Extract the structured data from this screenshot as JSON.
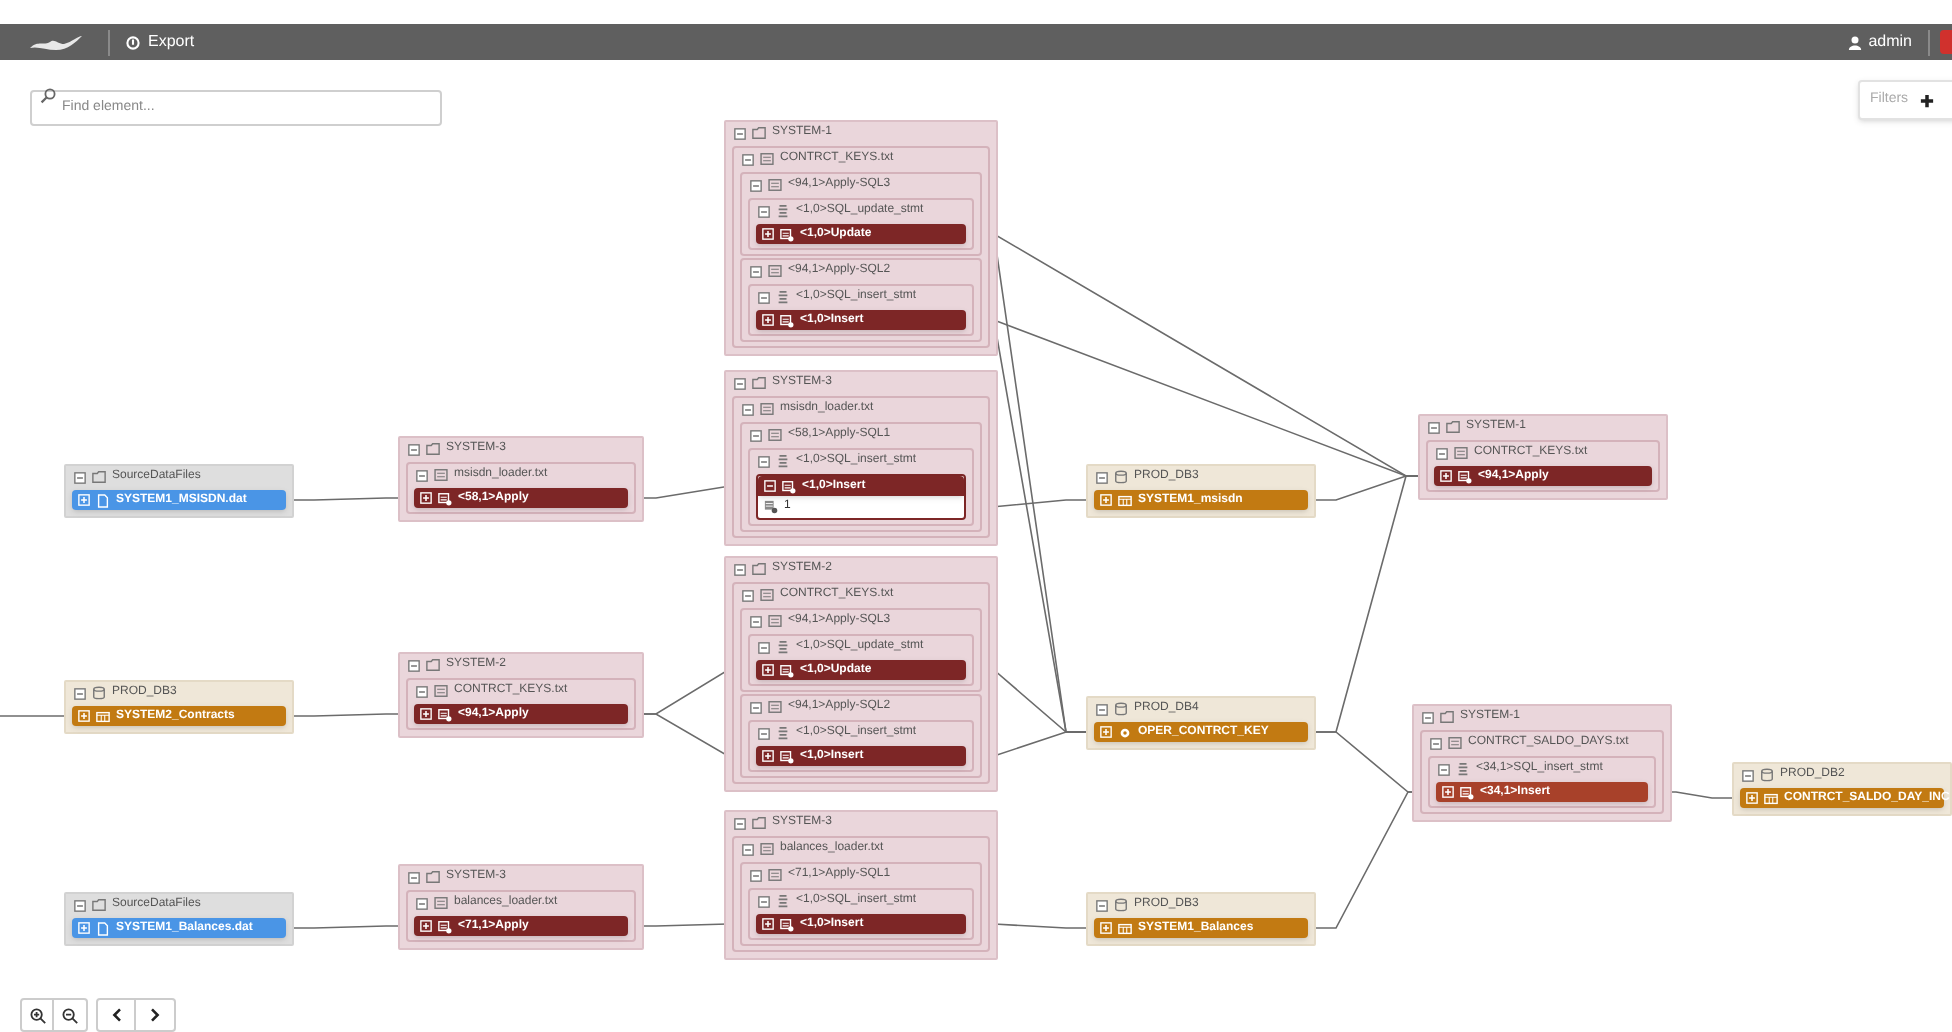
{
  "toolbar": {
    "export_label": "Export",
    "user": "admin"
  },
  "search": {
    "placeholder": "Find element..."
  },
  "filters": {
    "label": "Filters"
  },
  "nodes": [
    {
      "label": "SourceDataFiles",
      "kind": "source",
      "expanded": true,
      "children": [
        {
          "kind": "item",
          "label": "SYSTEM1_MSISDN.dat",
          "color": "#4a95e6",
          "expanded": false
        }
      ]
    },
    {
      "label": "PROD_DB3",
      "kind": "database",
      "expanded": true,
      "children": [
        {
          "kind": "item",
          "label": "SYSTEM2_Contracts",
          "color": "#c27a12",
          "expanded": false
        }
      ]
    },
    {
      "label": "SourceDataFiles",
      "kind": "source",
      "expanded": true,
      "children": [
        {
          "kind": "item",
          "label": "SYSTEM1_Balances.dat",
          "color": "#4a95e6",
          "expanded": false
        }
      ]
    },
    {
      "label": "SYSTEM-3",
      "kind": "system",
      "expanded": true,
      "children": [
        {
          "kind": "group",
          "label": "msisdn_loader.txt",
          "expanded": true,
          "children": [
            {
              "kind": "item",
              "label": "<58,1>Apply",
              "color": "#7d2626",
              "expanded": false
            }
          ]
        }
      ]
    },
    {
      "label": "SYSTEM-2",
      "kind": "system",
      "expanded": true,
      "children": [
        {
          "kind": "group",
          "label": "CONTRCT_KEYS.txt",
          "expanded": true,
          "children": [
            {
              "kind": "item",
              "label": "<94,1>Apply",
              "color": "#7d2626",
              "expanded": false
            }
          ]
        }
      ]
    },
    {
      "label": "SYSTEM-3",
      "kind": "system",
      "expanded": true,
      "children": [
        {
          "kind": "group",
          "label": "balances_loader.txt",
          "expanded": true,
          "children": [
            {
              "kind": "item",
              "label": "<71,1>Apply",
              "color": "#7d2626",
              "expanded": false
            }
          ]
        }
      ]
    },
    {
      "label": "SYSTEM-1",
      "kind": "system",
      "expanded": true,
      "children": [
        {
          "kind": "group",
          "label": "CONTRCT_KEYS.txt",
          "expanded": true,
          "children": [
            {
              "kind": "group",
              "label": "<94,1>Apply-SQL3",
              "expanded": true,
              "children": [
                {
                  "kind": "group",
                  "label": "<1,0>SQL_update_stmt",
                  "expanded": true,
                  "children": [
                    {
                      "kind": "item",
                      "label": "<1,0>Update",
                      "color": "#7d2626",
                      "expanded": false
                    }
                  ]
                }
              ]
            },
            {
              "kind": "group",
              "label": "<94,1>Apply-SQL2",
              "expanded": true,
              "children": [
                {
                  "kind": "group",
                  "label": "<1,0>SQL_insert_stmt",
                  "expanded": true,
                  "children": [
                    {
                      "kind": "item",
                      "label": "<1,0>Insert",
                      "color": "#7d2626",
                      "expanded": false
                    }
                  ]
                }
              ]
            }
          ]
        }
      ]
    },
    {
      "label": "SYSTEM-3",
      "kind": "system",
      "expanded": true,
      "children": [
        {
          "kind": "group",
          "label": "msisdn_loader.txt",
          "expanded": true,
          "children": [
            {
              "kind": "group",
              "label": "<58,1>Apply-SQL1",
              "expanded": true,
              "children": [
                {
                  "kind": "group",
                  "label": "<1,0>SQL_insert_stmt",
                  "expanded": true,
                  "children": [
                    {
                      "kind": "item",
                      "label": "<1,0>Insert",
                      "color": "#7d2626",
                      "expanded": true,
                      "rows": [
                        {
                          "label": "1"
                        }
                      ]
                    }
                  ]
                }
              ]
            }
          ]
        }
      ]
    },
    {
      "label": "SYSTEM-2",
      "kind": "system",
      "expanded": true,
      "children": [
        {
          "kind": "group",
          "label": "CONTRCT_KEYS.txt",
          "expanded": true,
          "children": [
            {
              "kind": "group",
              "label": "<94,1>Apply-SQL3",
              "expanded": true,
              "children": [
                {
                  "kind": "group",
                  "label": "<1,0>SQL_update_stmt",
                  "expanded": true,
                  "children": [
                    {
                      "kind": "item",
                      "label": "<1,0>Update",
                      "color": "#7d2626",
                      "expanded": false
                    }
                  ]
                }
              ]
            },
            {
              "kind": "group",
              "label": "<94,1>Apply-SQL2",
              "expanded": true,
              "children": [
                {
                  "kind": "group",
                  "label": "<1,0>SQL_insert_stmt",
                  "expanded": true,
                  "children": [
                    {
                      "kind": "item",
                      "label": "<1,0>Insert",
                      "color": "#7d2626",
                      "expanded": false
                    }
                  ]
                }
              ]
            }
          ]
        }
      ]
    },
    {
      "label": "SYSTEM-3",
      "kind": "system",
      "expanded": true,
      "children": [
        {
          "kind": "group",
          "label": "balances_loader.txt",
          "expanded": true,
          "children": [
            {
              "kind": "group",
              "label": "<71,1>Apply-SQL1",
              "expanded": true,
              "children": [
                {
                  "kind": "group",
                  "label": "<1,0>SQL_insert_stmt",
                  "expanded": true,
                  "children": [
                    {
                      "kind": "item",
                      "label": "<1,0>Insert",
                      "color": "#7d2626",
                      "expanded": false
                    }
                  ]
                }
              ]
            }
          ]
        }
      ]
    },
    {
      "label": "PROD_DB3",
      "kind": "database",
      "expanded": true,
      "children": [
        {
          "kind": "item",
          "label": "SYSTEM1_msisdn",
          "color": "#c27a12",
          "expanded": false
        }
      ]
    },
    {
      "label": "PROD_DB4",
      "kind": "database",
      "expanded": true,
      "children": [
        {
          "kind": "item",
          "label": "OPER_CONTRCT_KEY",
          "color": "#c27a12",
          "expanded": false
        }
      ]
    },
    {
      "label": "PROD_DB3",
      "kind": "database",
      "expanded": true,
      "children": [
        {
          "kind": "item",
          "label": "SYSTEM1_Balances",
          "color": "#c27a12",
          "expanded": false
        }
      ]
    },
    {
      "label": "SYSTEM-1",
      "kind": "system",
      "expanded": true,
      "children": [
        {
          "kind": "group",
          "label": "CONTRCT_KEYS.txt",
          "expanded": true,
          "children": [
            {
              "kind": "item",
              "label": "<94,1>Apply",
              "color": "#7d2626",
              "expanded": false
            }
          ]
        }
      ]
    },
    {
      "label": "SYSTEM-1",
      "kind": "system",
      "expanded": true,
      "children": [
        {
          "kind": "group",
          "label": "CONTRCT_SALDO_DAYS.txt",
          "expanded": true,
          "children": [
            {
              "kind": "group",
              "label": "<34,1>SQL_insert_stmt",
              "expanded": true,
              "children": [
                {
                  "kind": "item",
                  "label": "<34,1>Insert",
                  "color": "#a8412a",
                  "expanded": false
                }
              ]
            }
          ]
        }
      ]
    },
    {
      "label": "PROD_DB2",
      "kind": "database",
      "expanded": true,
      "children": [
        {
          "kind": "item",
          "label": "CONTRCT_SALDO_DAY_INC",
          "color": "#c27a12",
          "expanded": false
        }
      ]
    }
  ]
}
